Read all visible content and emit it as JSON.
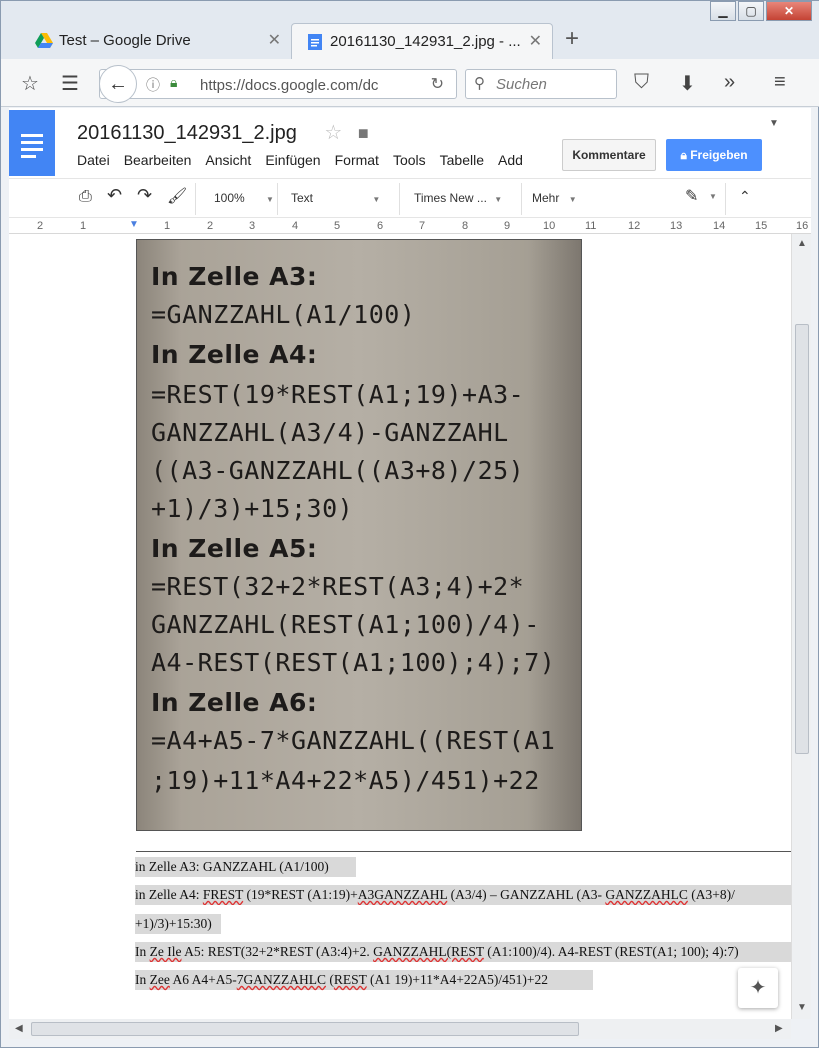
{
  "browser": {
    "tabs": [
      {
        "title": "Test – Google Drive",
        "icon": "google-drive-icon"
      },
      {
        "title": "20161130_142931_2.jpg - ...",
        "icon": "google-docs-icon"
      }
    ],
    "url": "https://docs.google.com/dc",
    "url_domain": "google.com",
    "search_placeholder": "Suchen"
  },
  "docs": {
    "title": "20161130_142931_2.jpg",
    "menu": [
      "Datei",
      "Bearbeiten",
      "Ansicht",
      "Einfügen",
      "Format",
      "Tools",
      "Tabelle",
      "Add"
    ],
    "comments_label": "Kommentare",
    "share_label": "Freigeben",
    "toolbar": {
      "zoom": "100%",
      "style": "Text",
      "font": "Times New ...",
      "more": "Mehr"
    },
    "ruler_marks": [
      "2",
      "1",
      "1",
      "1",
      "2",
      "3",
      "4",
      "5",
      "6",
      "7",
      "8",
      "9",
      "10",
      "11",
      "12",
      "13",
      "14",
      "15",
      "16"
    ]
  },
  "photo_text": {
    "l1": "In Zelle A3:",
    "l2": "=GANZZAHL(A1/100)",
    "l3": "In Zelle A4:",
    "l4": "=REST(19*REST(A1;19)+A3-",
    "l5": "GANZZAHL(A3/4)-GANZZAHL",
    "l6": "((A3-GANZZAHL((A3+8)/25)",
    "l7": "+1)/3)+15;30)",
    "l8": "In Zelle A5:",
    "l9": "=REST(32+2*REST(A3;4)+2*",
    "l10": "GANZZAHL(REST(A1;100)/4)-",
    "l11": "A4-REST(REST(A1;100);4);7)",
    "l12": "In Zelle A6:",
    "l13": "=A4+A5-7*GANZZAHL((REST(A1",
    "l14": ";19)+11*A4+22*A5)/451)+22"
  },
  "ocr_text": {
    "p1": "in Zelle A3: GANZZAHL (A1/100)",
    "p2a": "in Zelle A4: ",
    "p2b": "FREST",
    "p2c": " (19*REST (A1:19)+",
    "p2d": "A3GANZZAHL",
    "p2e": " (A3/4) – GANZZAHL (A3- ",
    "p2f": "GANZZAHLC",
    "p2g": " (A3+8)/",
    "p3": "+1)/3)+15:30)",
    "p4a": "In ",
    "p4b": "Ze Ile",
    "p4c": " A5: REST(32+2*REST (A3:4)+2. ",
    "p4d": "GANZZAHL(REST",
    "p4e": " (A1:100)/4). A4-REST (REST(A1; 100); 4):7)",
    "p5a": "In ",
    "p5b": "Zee",
    "p5c": " A6 A4+A5-",
    "p5d": "7GANZZAHLC",
    "p5e": " (",
    "p5f": "REST",
    "p5g": " (A1 19)+11*A4+22A5)/451)+22"
  }
}
